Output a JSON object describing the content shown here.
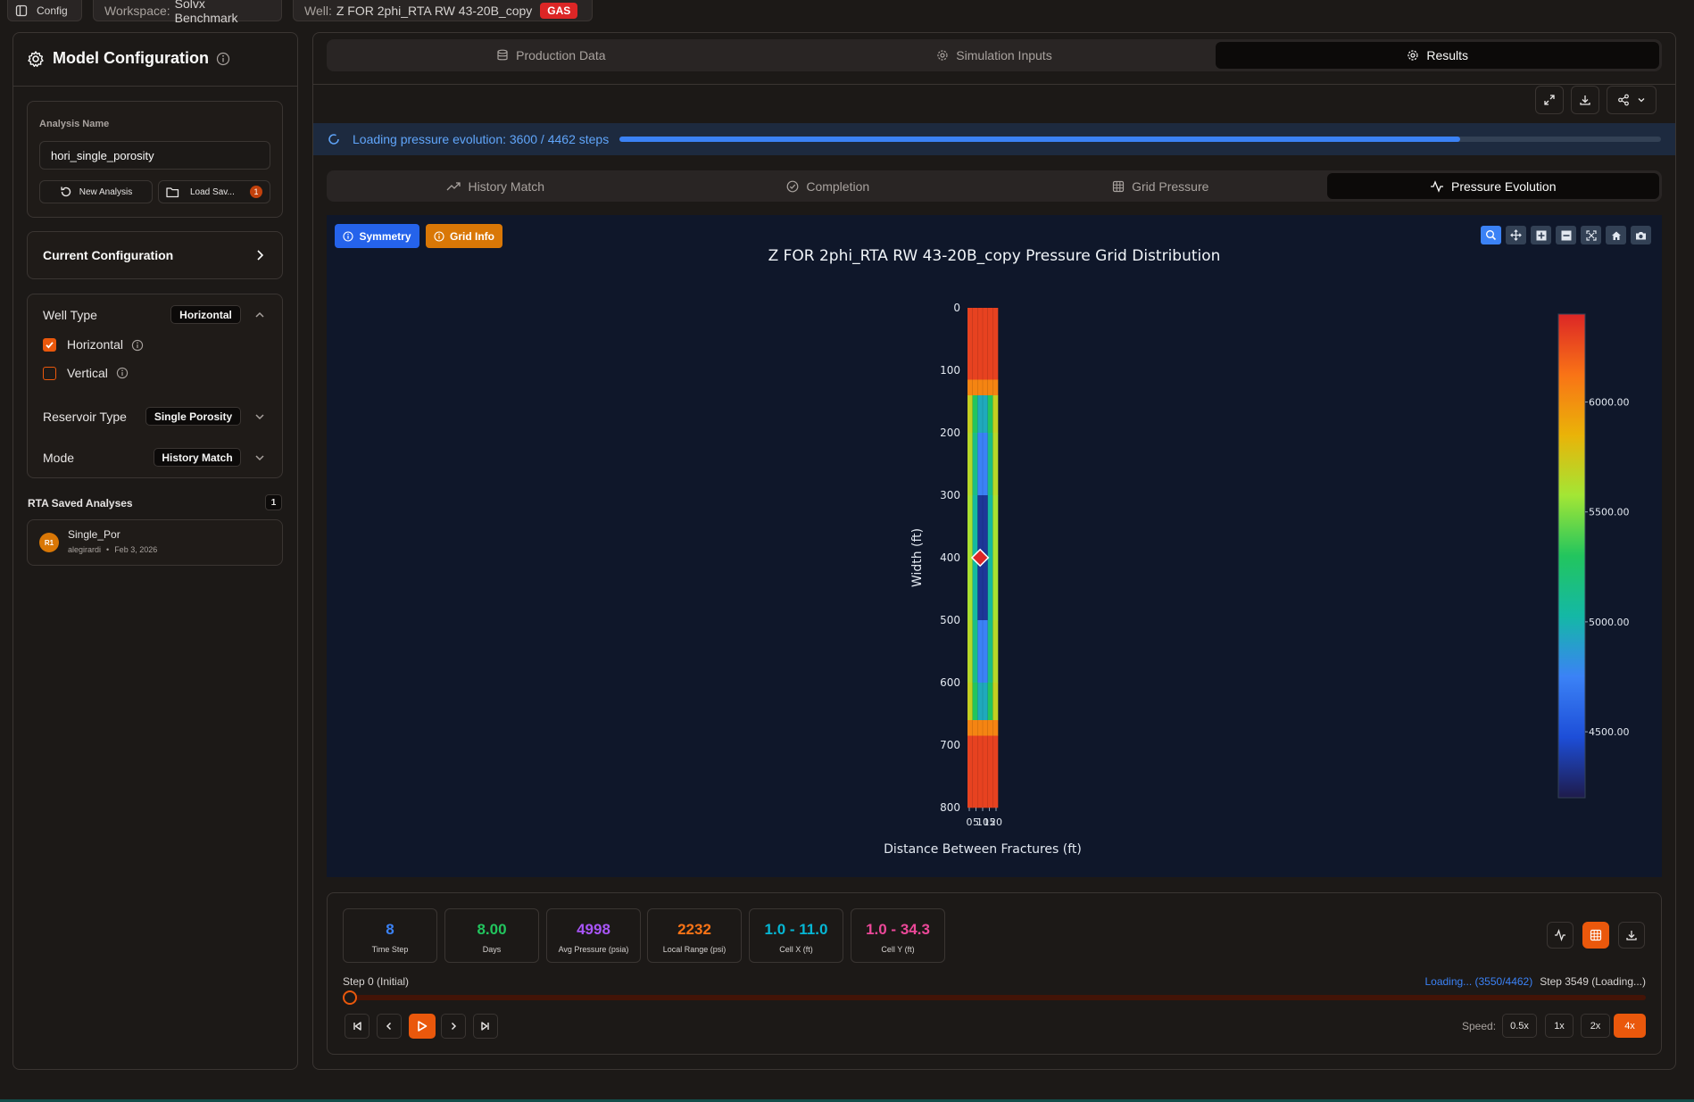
{
  "topbar": {
    "config_label": "Config",
    "workspace_prefix": "Workspace:",
    "workspace_name": "Solvx Benchmark",
    "well_prefix": "Well:",
    "well_name": "Z FOR 2phi_RTA RW 43-20B_copy",
    "well_badge": "GAS"
  },
  "sidebar": {
    "title": "Model Configuration",
    "analysis_name_label": "Analysis Name",
    "analysis_name_value": "hori_single_porosity",
    "new_analysis_label": "New Analysis",
    "load_saved_label": "Load Sav...",
    "load_saved_count": "1",
    "current_config_label": "Current Configuration",
    "well_type_label": "Well Type",
    "well_type_value": "Horizontal",
    "option_horizontal": "Horizontal",
    "option_vertical": "Vertical",
    "horizontal_checked": true,
    "vertical_checked": false,
    "reservoir_type_label": "Reservoir Type",
    "reservoir_type_value": "Single Porosity",
    "mode_label": "Mode",
    "mode_value": "History Match",
    "saved_title": "RTA Saved Analyses",
    "saved_count": "1",
    "saved_items": [
      {
        "avatar": "R1",
        "name": "Single_Por",
        "user": "alegirardi",
        "date": "Feb 3, 2026"
      }
    ]
  },
  "main_tabs": [
    "Production Data",
    "Simulation Inputs",
    "Results"
  ],
  "main_tab_active": 2,
  "loading": {
    "text": "Loading pressure evolution: 3600 / 4462 steps",
    "progress": 0.8068
  },
  "sub_tabs": [
    "History Match",
    "Completion",
    "Grid Pressure",
    "Pressure Evolution"
  ],
  "sub_tab_active": 3,
  "chart_buttons": {
    "symmetry": "Symmetry",
    "grid_info": "Grid Info"
  },
  "chart_data": {
    "type": "heatmap",
    "title": "Z FOR 2phi_RTA RW 43-20B_copy Pressure Grid Distribution",
    "xlabel": "Distance Between Fractures (ft)",
    "ylabel": "Width (ft)",
    "ylim": [
      0,
      800
    ],
    "y_ticks": [
      0,
      100,
      200,
      300,
      400,
      500,
      600,
      700,
      800
    ],
    "x_tick_labels": [
      "0",
      "5",
      "10",
      "15",
      "20"
    ],
    "colorbar_ticks": [
      "6000.00",
      "5500.00",
      "5000.00",
      "4500.00"
    ],
    "colorscale": [
      "#1e1b4b",
      "#1d4ed8",
      "#3b82f6",
      "#14b8a6",
      "#22c55e",
      "#a3e635",
      "#eab308",
      "#f97316",
      "#dc2626"
    ],
    "pressure_range": [
      4200,
      6400
    ],
    "columns": 6,
    "rows": [
      {
        "y0": 0,
        "y1": 115,
        "values": [
          6300,
          6300,
          6300,
          6300,
          6300,
          6300
        ]
      },
      {
        "y0": 115,
        "y1": 140,
        "values": [
          6050,
          6050,
          6050,
          6050,
          6050,
          6050
        ]
      },
      {
        "y0": 140,
        "y1": 200,
        "values": [
          5700,
          5300,
          4950,
          4950,
          5300,
          5700
        ]
      },
      {
        "y0": 200,
        "y1": 300,
        "values": [
          5650,
          5150,
          4750,
          4750,
          5150,
          5650
        ]
      },
      {
        "y0": 300,
        "y1": 500,
        "values": [
          5600,
          5050,
          4350,
          4350,
          5050,
          5600
        ]
      },
      {
        "y0": 500,
        "y1": 600,
        "values": [
          5650,
          5150,
          4750,
          4750,
          5150,
          5650
        ]
      },
      {
        "y0": 600,
        "y1": 660,
        "values": [
          5700,
          5300,
          4950,
          4950,
          5300,
          5700
        ]
      },
      {
        "y0": 660,
        "y1": 685,
        "values": [
          6050,
          6050,
          6050,
          6050,
          6050,
          6050
        ]
      },
      {
        "y0": 685,
        "y1": 800,
        "values": [
          6300,
          6300,
          6300,
          6300,
          6300,
          6300
        ]
      }
    ],
    "marker": {
      "x_col": 2.5,
      "y": 400
    },
    "grid": false
  },
  "stats": [
    {
      "value": "8",
      "label": "Time Step",
      "color": "#3b82f6"
    },
    {
      "value": "8.00",
      "label": "Days",
      "color": "#22c55e"
    },
    {
      "value": "4998",
      "label": "Avg Pressure (psia)",
      "color": "#a855f7"
    },
    {
      "value": "2232",
      "label": "Local Range (psi)",
      "color": "#f97316"
    },
    {
      "value": "1.0 - 11.0",
      "label": "Cell X (ft)",
      "color": "#06b6d4"
    },
    {
      "value": "1.0 - 34.3",
      "label": "Cell Y (ft)",
      "color": "#ec4899"
    }
  ],
  "playback": {
    "step_label": "Step 0 (Initial)",
    "loading_text": "Loading... (3550/4462)",
    "step_status": "Step 3549 (Loading...)",
    "position": 0,
    "speed_label": "Speed:",
    "speeds": [
      "0.5x",
      "1x",
      "2x",
      "4x"
    ],
    "active_speed": 3
  }
}
